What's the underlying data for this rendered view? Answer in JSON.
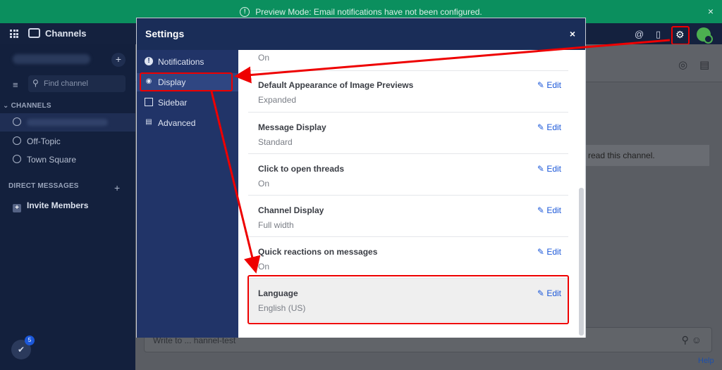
{
  "banner": {
    "text": "Preview Mode: Email notifications have not been configured.",
    "close": "×"
  },
  "topbar": {
    "title": "Channels"
  },
  "sidebar": {
    "find_placeholder": "Find channel",
    "channels_header": "CHANNELS",
    "channels": [
      "Off-Topic",
      "Town Square"
    ],
    "direct_messages_header": "DIRECT MESSAGES",
    "invite_label": "Invite Members",
    "badge_count": "5"
  },
  "main": {
    "intro_text": "read this channel.",
    "composer_placeholder": "Write to ... hannel-test",
    "help_label": "Help"
  },
  "modal": {
    "title": "Settings",
    "close": "×",
    "nav": [
      {
        "label": "Notifications",
        "icon": "exclamation-circle-icon"
      },
      {
        "label": "Display",
        "icon": "eye-icon"
      },
      {
        "label": "Sidebar",
        "icon": "columns-icon"
      },
      {
        "label": "Advanced",
        "icon": "keyboard-icon"
      }
    ],
    "top_value": "On",
    "edit_label": "Edit",
    "settings": [
      {
        "label": "Default Appearance of Image Previews",
        "value": "Expanded"
      },
      {
        "label": "Message Display",
        "value": "Standard"
      },
      {
        "label": "Click to open threads",
        "value": "On"
      },
      {
        "label": "Channel Display",
        "value": "Full width"
      },
      {
        "label": "Quick reactions on messages",
        "value": "On"
      },
      {
        "label": "Language",
        "value": "English (US)"
      }
    ]
  },
  "colors": {
    "annotation": "#ee0000",
    "accent": "#1c58d9",
    "banner": "#0b8f5e"
  }
}
